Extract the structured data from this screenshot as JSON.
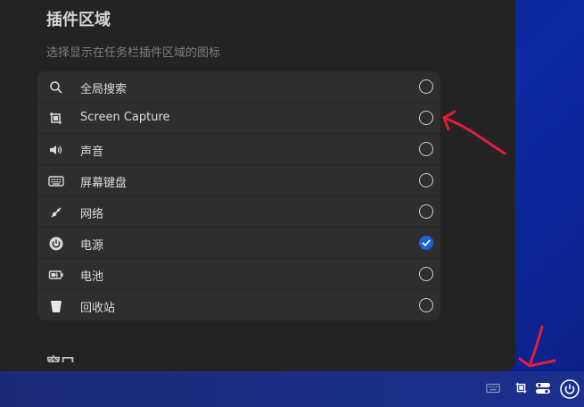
{
  "section": {
    "title": "插件区域",
    "description": "选择显示在任务栏插件区域的图标"
  },
  "plugins": [
    {
      "label": "全局搜索",
      "icon": "search-icon",
      "checked": false
    },
    {
      "label": "Screen Capture",
      "icon": "screen-capture-icon",
      "checked": false
    },
    {
      "label": "声音",
      "icon": "speaker-icon",
      "checked": false
    },
    {
      "label": "屏幕键盘",
      "icon": "keyboard-icon",
      "checked": false
    },
    {
      "label": "网络",
      "icon": "network-icon",
      "checked": false
    },
    {
      "label": "电源",
      "icon": "power-icon",
      "checked": true
    },
    {
      "label": "电池",
      "icon": "battery-icon",
      "checked": false
    },
    {
      "label": "回收站",
      "icon": "trash-icon",
      "checked": false
    }
  ],
  "next_section": {
    "title": "窗口"
  },
  "taskbar": {
    "tray": [
      "keyboard-icon",
      "screen-capture-icon",
      "toggle-icon",
      "power-icon"
    ]
  },
  "colors": {
    "accent": "#1e62d6",
    "annotation": "#e0203a"
  }
}
